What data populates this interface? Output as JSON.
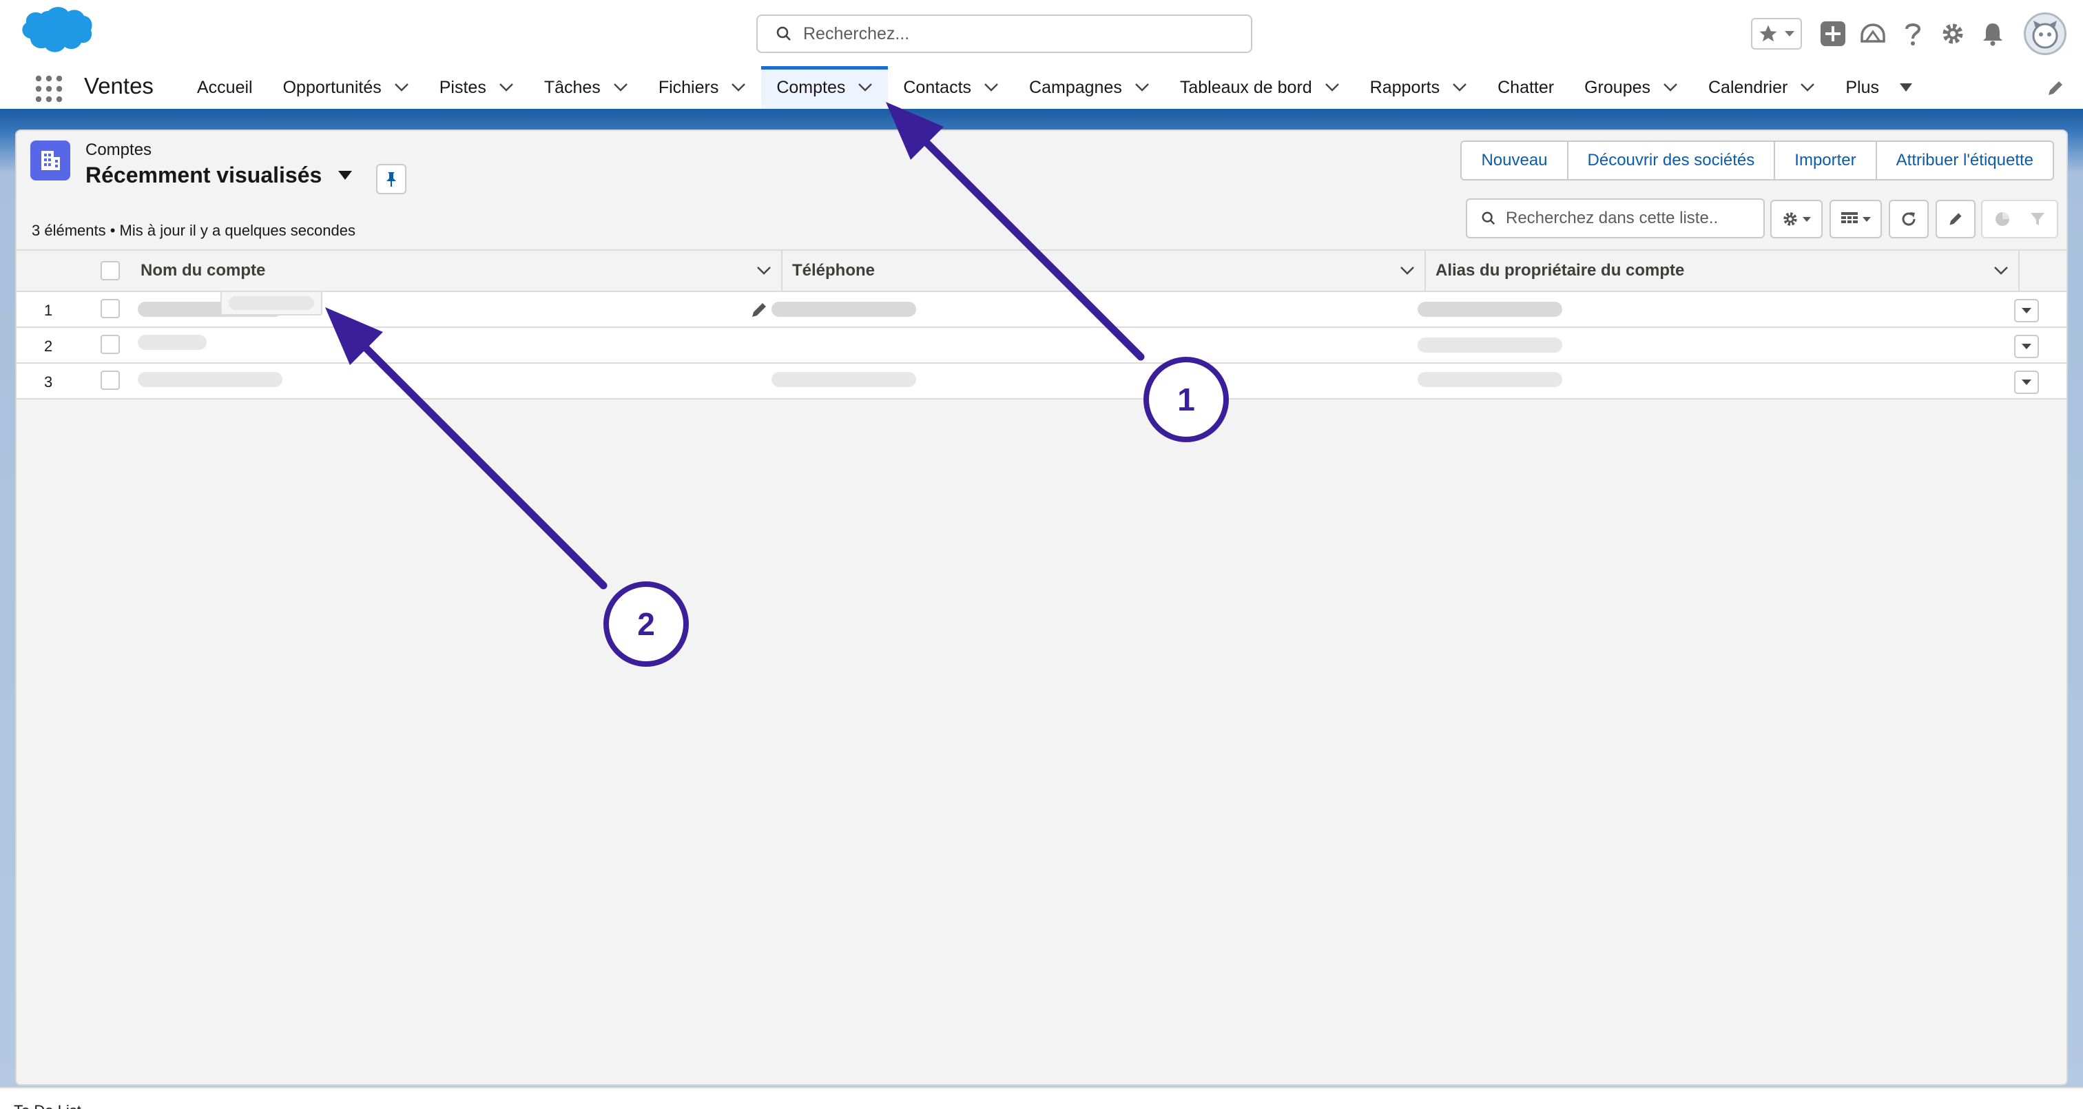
{
  "header": {
    "search_placeholder": "Recherchez...",
    "icons": [
      "favorites-star-icon",
      "global-add-icon",
      "trailhead-icon",
      "help-icon",
      "setup-gear-icon",
      "notifications-bell-icon",
      "user-avatar"
    ]
  },
  "nav": {
    "app_name": "Ventes",
    "items": [
      {
        "label": "Accueil",
        "dropdown": false
      },
      {
        "label": "Opportunités",
        "dropdown": true
      },
      {
        "label": "Pistes",
        "dropdown": true
      },
      {
        "label": "Tâches",
        "dropdown": true
      },
      {
        "label": "Fichiers",
        "dropdown": true
      },
      {
        "label": "Comptes",
        "dropdown": true,
        "active": true
      },
      {
        "label": "Contacts",
        "dropdown": true
      },
      {
        "label": "Campagnes",
        "dropdown": true
      },
      {
        "label": "Tableaux de bord",
        "dropdown": true
      },
      {
        "label": "Rapports",
        "dropdown": true
      },
      {
        "label": "Chatter",
        "dropdown": false
      },
      {
        "label": "Groupes",
        "dropdown": true
      },
      {
        "label": "Calendrier",
        "dropdown": true
      }
    ],
    "more_label": "Plus",
    "accent_color": "#1b6ed1"
  },
  "list_view": {
    "object_label": "Comptes",
    "title": "Récemment visualisés",
    "meta": "3 éléments • Mis à jour il y a quelques secondes",
    "actions": [
      "Nouveau",
      "Découvrir des sociétés",
      "Importer",
      "Attribuer l'étiquette"
    ],
    "search_placeholder": "Recherchez dans cette liste..",
    "columns": [
      "Nom du compte",
      "Téléphone",
      "Alias du propriétaire du compte"
    ],
    "rows": [
      {
        "num": "1"
      },
      {
        "num": "2"
      },
      {
        "num": "3"
      }
    ]
  },
  "annotations": {
    "callout_1": "1",
    "callout_2": "2",
    "arrow_color": "#3b1f9a"
  },
  "utility_bar": {
    "item": "To Do List"
  }
}
